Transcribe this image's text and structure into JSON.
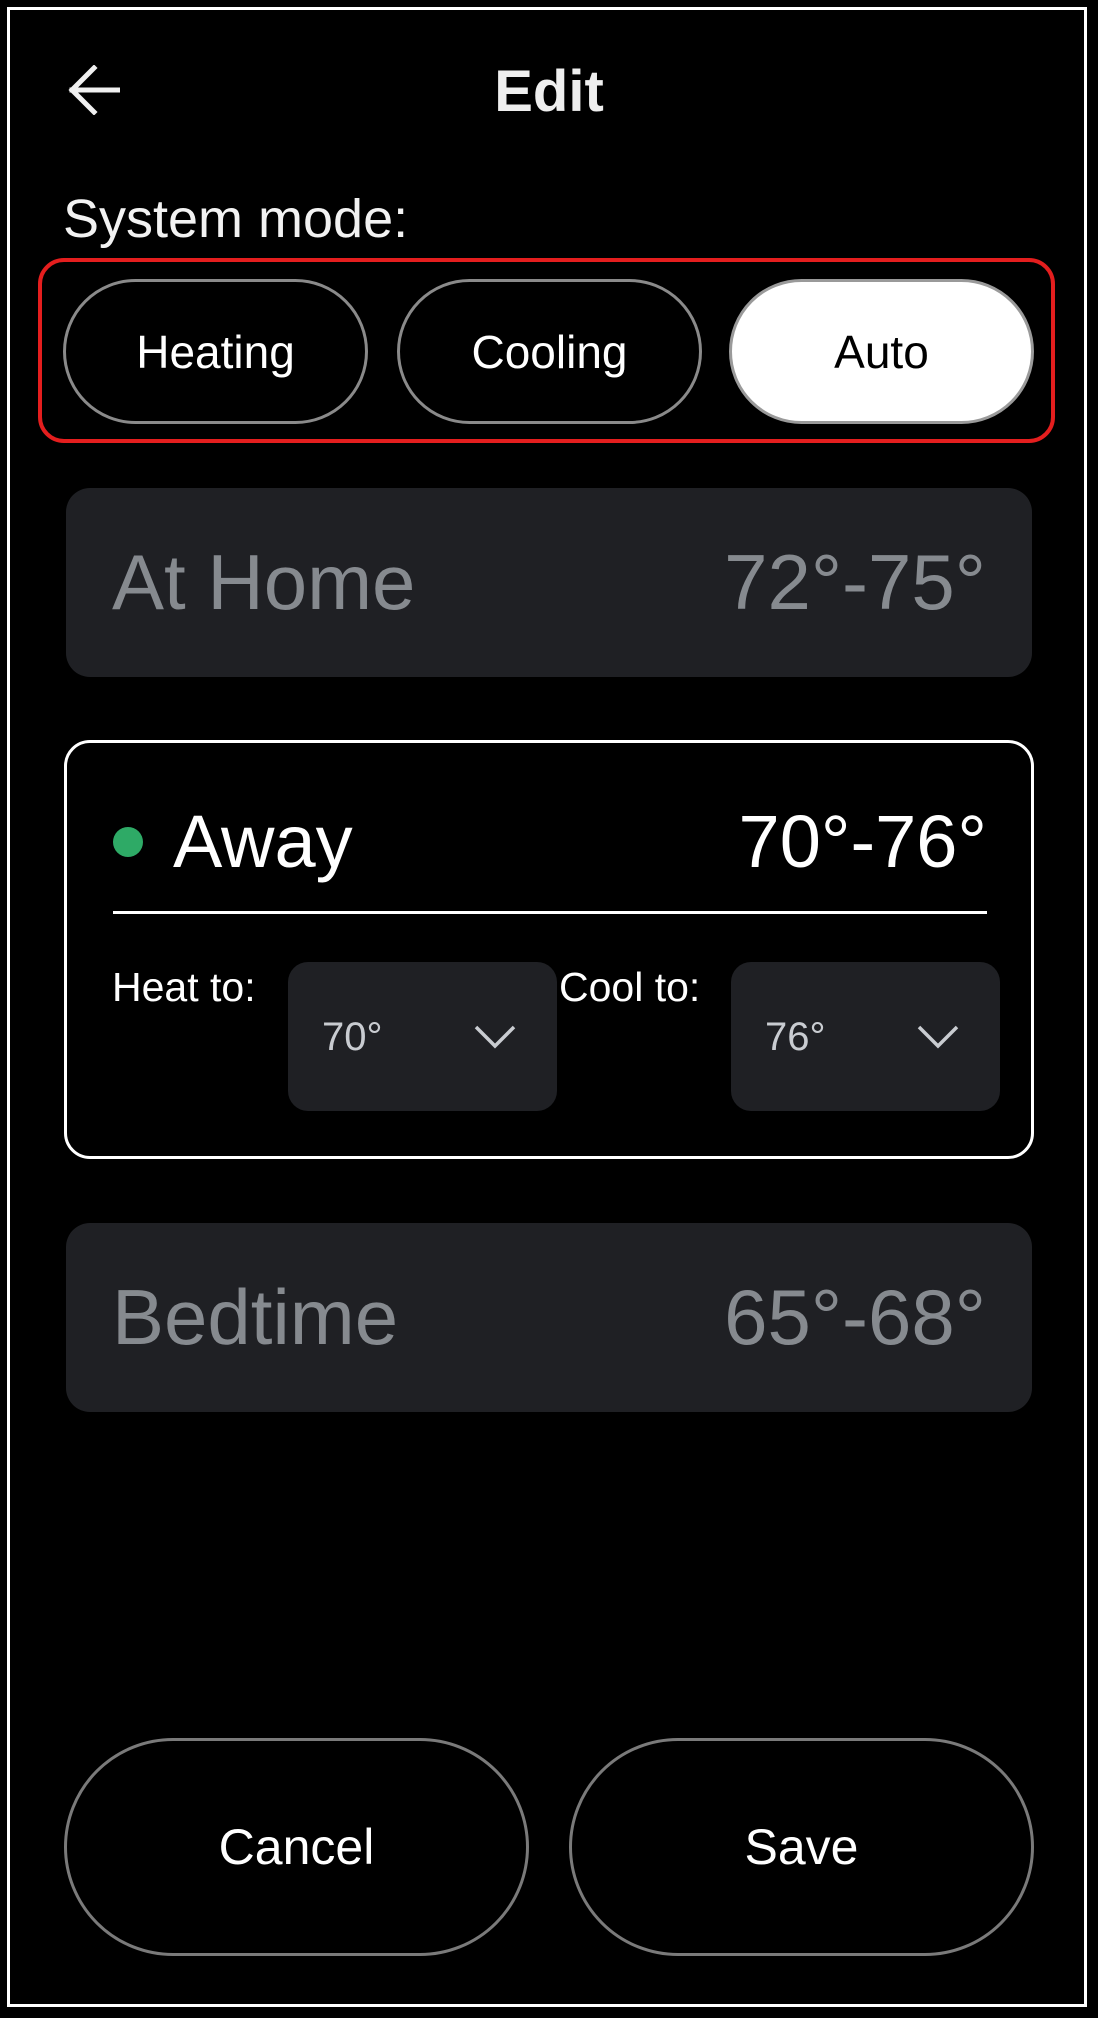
{
  "header": {
    "title": "Edit",
    "back_icon": "arrow-left-icon"
  },
  "system_mode": {
    "label": "System mode:",
    "options": [
      {
        "label": "Heating",
        "selected": false
      },
      {
        "label": "Cooling",
        "selected": false
      },
      {
        "label": "Auto",
        "selected": true
      }
    ],
    "highlight_color": "#e41e1e"
  },
  "presets": [
    {
      "name": "At Home",
      "range": "72°-75°",
      "expanded": false
    },
    {
      "name": "Away",
      "range": "70°-76°",
      "expanded": true,
      "active": true,
      "status_color": "#2eaa66",
      "heat": {
        "label": "Heat to:",
        "value": "70°"
      },
      "cool": {
        "label": "Cool to:",
        "value": "76°"
      }
    },
    {
      "name": "Bedtime",
      "range": "65°-68°",
      "expanded": false
    }
  ],
  "footer": {
    "cancel_label": "Cancel",
    "save_label": "Save"
  },
  "colors": {
    "background": "#000000",
    "card_bg": "#1f2024",
    "muted_text": "#868a8f",
    "dropdown_text": "#c9ccd1"
  }
}
